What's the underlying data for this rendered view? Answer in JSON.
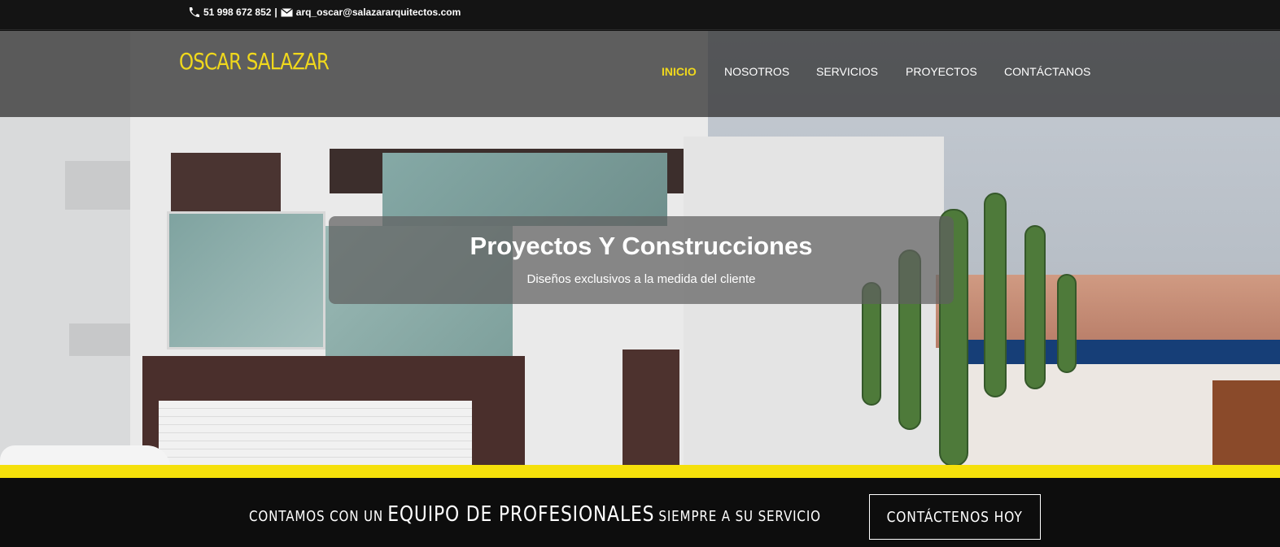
{
  "topbar": {
    "phone_icon": "phone-icon",
    "phone": "51 998 672 852",
    "separator": "|",
    "mail_icon": "envelope-icon",
    "email": "arq_oscar@salazararquitectos.com"
  },
  "header": {
    "logo": "OSCAR SALAZAR",
    "nav": [
      {
        "label": "INICIO",
        "active": true
      },
      {
        "label": "NOSOTROS",
        "active": false
      },
      {
        "label": "SERVICIOS",
        "active": false
      },
      {
        "label": "PROYECTOS",
        "active": false
      },
      {
        "label": "CONTÁCTANOS",
        "active": false
      }
    ]
  },
  "hero": {
    "title": "Proyectos Y Construcciones",
    "subtitle": "Diseños exclusivos a la medida del cliente"
  },
  "cta": {
    "text_part1": "CONTAMOS CON UN",
    "text_highlight": "EQUIPO DE PROFESIONALES",
    "text_part2": "SIEMPRE A SU SERVICIO",
    "button": "CONTÁCTENOS HOY"
  },
  "colors": {
    "accent": "#f0d81c",
    "strip": "#f5e00b",
    "topbar_bg": "#141414",
    "cta_bg": "#0d0d0d"
  }
}
